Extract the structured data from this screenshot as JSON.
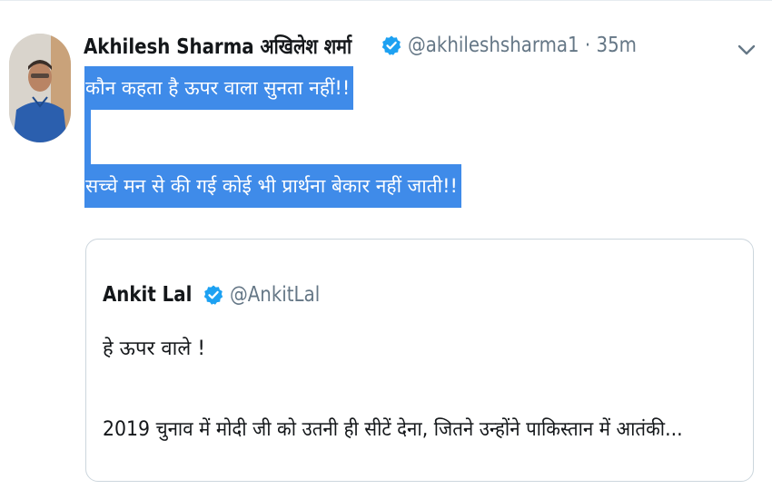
{
  "tweet": {
    "author_name": "Akhilesh Sharma अखिलेश शर्मा",
    "handle": "@akhileshsharma1",
    "separator": "·",
    "time": "35m",
    "text_line1": "कौन कहता है ऊपर वाला सुनता नहीं!!",
    "text_line2": "सच्चे मन से की गई कोई भी प्रार्थना बेकार नहीं जाती!!",
    "verified_icon": "verified-badge-icon",
    "menu_icon": "chevron-down-icon"
  },
  "quoted_tweet": {
    "author_name": "Ankit Lal",
    "handle": "@AnkitLal",
    "text_line1": "हे ऊपर वाले !",
    "text_line2": "2019 चुनाव में मोदी जी को उतनी ही सीटें देना, जितने उन्होंने पाकिस्तान में आतंकी..."
  },
  "colors": {
    "verified": "#1da1f2",
    "selection": "#3f8be9",
    "secondary_text": "#657786",
    "border": "#ccd6dd"
  }
}
